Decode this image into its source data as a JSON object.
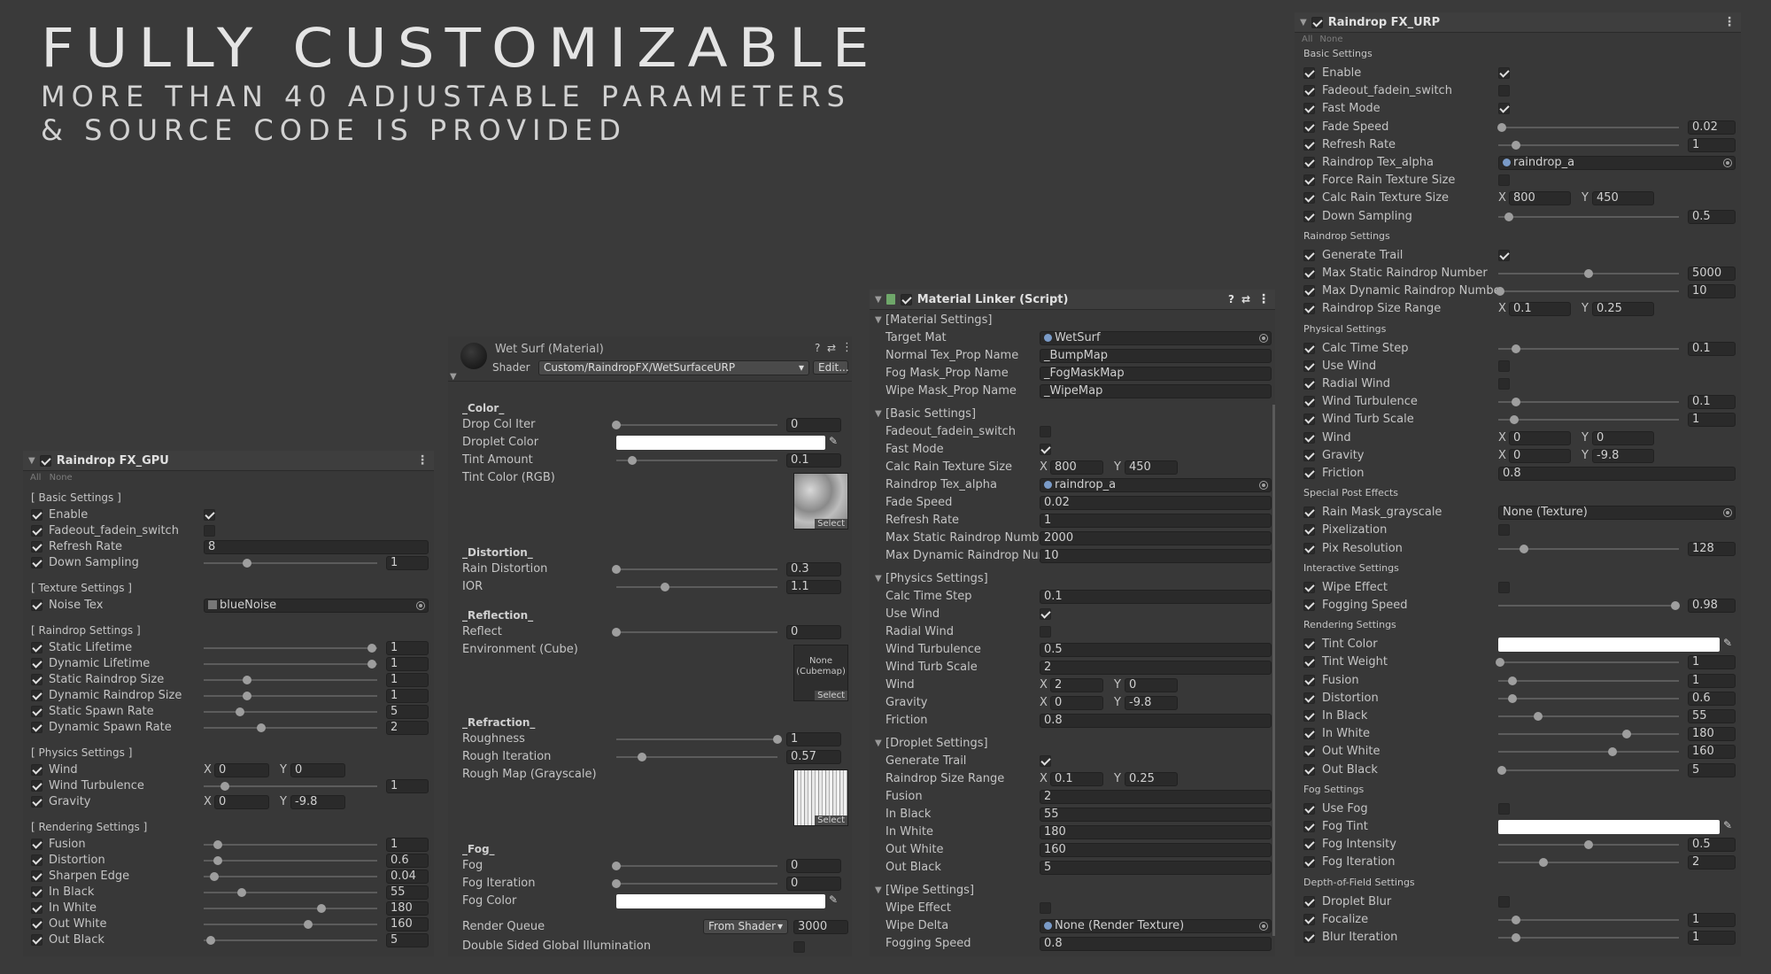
{
  "hero": {
    "title": "FULLY CUSTOMIZABLE",
    "line1": "MORE THAN 40 ADJUSTABLE PARAMETERS",
    "line2": "& SOURCE CODE IS PROVIDED"
  },
  "gpu": {
    "title": "Raindrop FX_GPU",
    "all": "All",
    "none": "None",
    "sections": [
      {
        "title": "[ Basic Settings ]",
        "rows": [
          {
            "label": "Enable",
            "type": "check",
            "on": true
          },
          {
            "label": "Fadeout_fadein_switch",
            "type": "check",
            "on": false
          },
          {
            "label": "Refresh Rate",
            "type": "field",
            "value": "8"
          },
          {
            "label": "Down Sampling",
            "type": "slider",
            "value": "1",
            "pos": 0.25
          }
        ]
      },
      {
        "title": "[ Texture Settings ]",
        "rows": [
          {
            "label": "Noise Tex",
            "type": "obj",
            "value": "blueNoise"
          }
        ]
      },
      {
        "title": "[ Raindrop Settings ]",
        "rows": [
          {
            "label": "Static Lifetime",
            "type": "slider",
            "value": "1",
            "pos": 0.97
          },
          {
            "label": "Dynamic Lifetime",
            "type": "slider",
            "value": "1",
            "pos": 0.97
          },
          {
            "label": "Static Raindrop Size",
            "type": "slider",
            "value": "1",
            "pos": 0.25
          },
          {
            "label": "Dynamic Raindrop Size",
            "type": "slider",
            "value": "1",
            "pos": 0.25
          },
          {
            "label": "Static Spawn Rate",
            "type": "slider",
            "value": "5",
            "pos": 0.21
          },
          {
            "label": "Dynamic Spawn Rate",
            "type": "slider",
            "value": "2",
            "pos": 0.33
          }
        ]
      },
      {
        "title": "[ Physics Settings ]",
        "rows": [
          {
            "label": "Wind",
            "type": "xy",
            "x": "0",
            "y": "0"
          },
          {
            "label": "Wind Turbulence",
            "type": "slider",
            "value": "1",
            "pos": 0.12
          },
          {
            "label": "Gravity",
            "type": "xy",
            "x": "0",
            "y": "-9.8"
          }
        ]
      },
      {
        "title": "[ Rendering Settings ]",
        "rows": [
          {
            "label": "Fusion",
            "type": "slider",
            "value": "1",
            "pos": 0.08
          },
          {
            "label": "Distortion",
            "type": "slider",
            "value": "0.6",
            "pos": 0.08
          },
          {
            "label": "Sharpen Edge",
            "type": "slider",
            "value": "0.04",
            "pos": 0.06
          },
          {
            "label": "In Black",
            "type": "slider",
            "value": "55",
            "pos": 0.22
          },
          {
            "label": "In White",
            "type": "slider",
            "value": "180",
            "pos": 0.68
          },
          {
            "label": "Out White",
            "type": "slider",
            "value": "160",
            "pos": 0.6
          },
          {
            "label": "Out Black",
            "type": "slider",
            "value": "5",
            "pos": 0.04
          }
        ]
      }
    ]
  },
  "mat": {
    "title": "Wet Surf (Material)",
    "shader_label": "Shader",
    "shader": "Custom/RaindropFX/WetSurfaceURP",
    "edit": "Edit...",
    "groups": [
      {
        "title": "_Color_",
        "rows": [
          {
            "label": "Drop Col Iter",
            "type": "slider",
            "value": "0",
            "pos": 0.0
          },
          {
            "label": "Droplet Color",
            "type": "color"
          },
          {
            "label": "Tint Amount",
            "type": "slider",
            "value": "0.1",
            "pos": 0.1
          },
          {
            "label": "Tint Color (RGB)",
            "type": "tex",
            "kind": "noise",
            "select": "Select"
          }
        ]
      },
      {
        "title": "_Distortion_",
        "rows": [
          {
            "label": "Rain Distortion",
            "type": "slider",
            "value": "0.3",
            "pos": 0.0
          },
          {
            "label": "IOR",
            "type": "slider",
            "value": "1.1",
            "pos": 0.3
          }
        ]
      },
      {
        "title": "_Reflection_",
        "rows": [
          {
            "label": "Reflect",
            "type": "slider",
            "value": "0",
            "pos": 0.0
          },
          {
            "label": "Environment (Cube)",
            "type": "tex",
            "kind": "cube",
            "none": "None (Cubemap)",
            "select": "Select"
          }
        ]
      },
      {
        "title": "_Refraction_",
        "rows": [
          {
            "label": "Roughness",
            "type": "slider",
            "value": "1",
            "pos": 1.0
          },
          {
            "label": "Rough Iteration",
            "type": "slider",
            "value": "0.57",
            "pos": 0.16
          },
          {
            "label": "Rough Map (Grayscale)",
            "type": "tex",
            "kind": "stripes",
            "select": "Select"
          }
        ]
      },
      {
        "title": "_Fog_",
        "rows": [
          {
            "label": "Fog",
            "type": "slider",
            "value": "0",
            "pos": 0.0
          },
          {
            "label": "Fog Iteration",
            "type": "slider",
            "value": "0",
            "pos": 0.0
          },
          {
            "label": "Fog Color",
            "type": "color"
          }
        ]
      }
    ],
    "render_queue_label": "Render Queue",
    "render_queue_mode": "From Shader",
    "render_queue_value": "3000",
    "dsgi_label": "Double Sided Global Illumination"
  },
  "linker": {
    "title": "Material Linker (Script)",
    "groups": [
      {
        "title": "[Material Settings]",
        "rows": [
          {
            "label": "Target Mat",
            "type": "obj",
            "value": "WetSurf"
          },
          {
            "label": "Normal Tex_Prop Name",
            "type": "field",
            "value": "_BumpMap"
          },
          {
            "label": "Fog Mask_Prop Name",
            "type": "field",
            "value": "_FogMaskMap"
          },
          {
            "label": "Wipe Mask_Prop Name",
            "type": "field",
            "value": "_WipeMap"
          }
        ]
      },
      {
        "title": "[Basic Settings]",
        "rows": [
          {
            "label": "Fadeout_fadein_switch",
            "type": "check",
            "on": false
          },
          {
            "label": "Fast Mode",
            "type": "check",
            "on": true
          },
          {
            "label": "Calc Rain Texture Size",
            "type": "xy",
            "x": "800",
            "y": "450"
          },
          {
            "label": "Raindrop Tex_alpha",
            "type": "obj",
            "value": "raindrop_a"
          },
          {
            "label": "Fade Speed",
            "type": "field",
            "value": "0.02"
          },
          {
            "label": "Refresh Rate",
            "type": "field",
            "value": "1"
          },
          {
            "label": "Max Static Raindrop Number",
            "type": "field",
            "value": "2000"
          },
          {
            "label": "Max Dynamic Raindrop Numbe",
            "type": "field",
            "value": "10"
          }
        ]
      },
      {
        "title": "[Physics Settings]",
        "rows": [
          {
            "label": "Calc Time Step",
            "type": "field",
            "value": "0.1"
          },
          {
            "label": "Use Wind",
            "type": "check",
            "on": true
          },
          {
            "label": "Radial Wind",
            "type": "check",
            "on": false
          },
          {
            "label": "Wind Turbulence",
            "type": "field",
            "value": "0.5"
          },
          {
            "label": "Wind Turb Scale",
            "type": "field",
            "value": "2"
          },
          {
            "label": "Wind",
            "type": "xy",
            "x": "2",
            "y": "0"
          },
          {
            "label": "Gravity",
            "type": "xy",
            "x": "0",
            "y": "-9.8"
          },
          {
            "label": "Friction",
            "type": "field",
            "value": "0.8"
          }
        ]
      },
      {
        "title": "[Droplet Settings]",
        "rows": [
          {
            "label": "Generate Trail",
            "type": "check",
            "on": true
          },
          {
            "label": "Raindrop Size Range",
            "type": "xy",
            "x": "0.1",
            "y": "0.25"
          },
          {
            "label": "Fusion",
            "type": "field",
            "value": "2"
          },
          {
            "label": "In Black",
            "type": "field",
            "value": "55"
          },
          {
            "label": "In White",
            "type": "field",
            "value": "180"
          },
          {
            "label": "Out White",
            "type": "field",
            "value": "160"
          },
          {
            "label": "Out Black",
            "type": "field",
            "value": "5"
          }
        ]
      },
      {
        "title": "[Wipe Settings]",
        "rows": [
          {
            "label": "Wipe Effect",
            "type": "check",
            "on": false
          },
          {
            "label": "Wipe Delta",
            "type": "obj",
            "value": "None (Render Texture)"
          },
          {
            "label": "Fogging Speed",
            "type": "field",
            "value": "0.8"
          }
        ]
      }
    ]
  },
  "urp": {
    "title": "Raindrop FX_URP",
    "all": "All",
    "none": "None",
    "sections": [
      {
        "title": "Basic Settings",
        "rows": [
          {
            "label": "Enable",
            "type": "check",
            "on": true
          },
          {
            "label": "Fadeout_fadein_switch",
            "type": "check",
            "on": false
          },
          {
            "label": "Fast Mode",
            "type": "check",
            "on": true
          },
          {
            "label": "Fade Speed",
            "type": "slider",
            "value": "0.02",
            "pos": 0.02
          },
          {
            "label": "Refresh Rate",
            "type": "slider",
            "value": "1",
            "pos": 0.1
          },
          {
            "label": "Raindrop Tex_alpha",
            "type": "obj",
            "value": "raindrop_a"
          },
          {
            "label": "Force Rain Texture Size",
            "type": "check",
            "on": false
          },
          {
            "label": "Calc Rain Texture Size",
            "type": "xy",
            "x": "800",
            "y": "450"
          },
          {
            "label": "Down Sampling",
            "type": "slider",
            "value": "0.5",
            "pos": 0.06
          }
        ]
      },
      {
        "title": "Raindrop Settings",
        "rows": [
          {
            "label": "Generate Trail",
            "type": "check",
            "on": true
          },
          {
            "label": "Max Static Raindrop Number",
            "type": "slider",
            "value": "5000",
            "pos": 0.5
          },
          {
            "label": "Max Dynamic Raindrop Numbe",
            "type": "slider",
            "value": "10",
            "pos": 0.01
          },
          {
            "label": "Raindrop Size Range",
            "type": "xy",
            "x": "0.1",
            "y": "0.25"
          }
        ]
      },
      {
        "title": "Physical Settings",
        "rows": [
          {
            "label": "Calc Time Step",
            "type": "slider",
            "value": "0.1",
            "pos": 0.1
          },
          {
            "label": "Use Wind",
            "type": "check",
            "on": false
          },
          {
            "label": "Radial Wind",
            "type": "check",
            "on": false
          },
          {
            "label": "Wind Turbulence",
            "type": "slider",
            "value": "0.1",
            "pos": 0.1
          },
          {
            "label": "Wind Turb Scale",
            "type": "slider",
            "value": "1",
            "pos": 0.09
          },
          {
            "label": "Wind",
            "type": "xy",
            "x": "0",
            "y": "0"
          },
          {
            "label": "Gravity",
            "type": "xy",
            "x": "0",
            "y": "-9.8"
          },
          {
            "label": "Friction",
            "type": "field",
            "value": "0.8"
          }
        ]
      },
      {
        "title": "Special Post Effects",
        "rows": [
          {
            "label": "Rain Mask_grayscale",
            "type": "objnone",
            "value": "None (Texture)"
          },
          {
            "label": "Pixelization",
            "type": "check",
            "on": false
          },
          {
            "label": "Pix Resolution",
            "type": "slider",
            "value": "128",
            "pos": 0.14
          }
        ]
      },
      {
        "title": "Interactive Settings",
        "rows": [
          {
            "label": "Wipe Effect",
            "type": "check",
            "on": false
          },
          {
            "label": "Fogging Speed",
            "type": "slider",
            "value": "0.98",
            "pos": 0.98
          }
        ]
      },
      {
        "title": "Rendering Settings",
        "rows": [
          {
            "label": "Tint Color",
            "type": "color"
          },
          {
            "label": "Tint Weight",
            "type": "slider",
            "value": "1",
            "pos": 0.01
          },
          {
            "label": "Fusion",
            "type": "slider",
            "value": "1",
            "pos": 0.08
          },
          {
            "label": "Distortion",
            "type": "slider",
            "value": "0.6",
            "pos": 0.08
          },
          {
            "label": "In Black",
            "type": "slider",
            "value": "55",
            "pos": 0.22
          },
          {
            "label": "In White",
            "type": "slider",
            "value": "180",
            "pos": 0.71
          },
          {
            "label": "Out White",
            "type": "slider",
            "value": "160",
            "pos": 0.63
          },
          {
            "label": "Out Black",
            "type": "slider",
            "value": "5",
            "pos": 0.02
          }
        ]
      },
      {
        "title": "Fog Settings",
        "rows": [
          {
            "label": "Use Fog",
            "type": "check",
            "on": false
          },
          {
            "label": "Fog Tint",
            "type": "color"
          },
          {
            "label": "Fog Intensity",
            "type": "slider",
            "value": "0.5",
            "pos": 0.5
          },
          {
            "label": "Fog Iteration",
            "type": "slider",
            "value": "2",
            "pos": 0.25
          }
        ]
      },
      {
        "title": "Depth-of-Field Settings",
        "rows": [
          {
            "label": "Droplet Blur",
            "type": "check",
            "on": false
          },
          {
            "label": "Focalize",
            "type": "slider",
            "value": "1",
            "pos": 0.1
          },
          {
            "label": "Blur Iteration",
            "type": "slider",
            "value": "1",
            "pos": 0.1
          }
        ]
      }
    ]
  }
}
